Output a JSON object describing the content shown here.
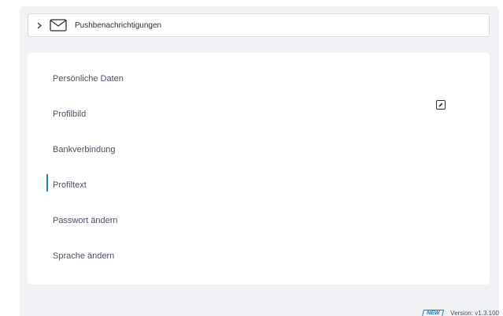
{
  "push_notifications": {
    "label": "Pushbenachrichtigungen",
    "chevron_icon": "chevron-right-icon",
    "mail_icon": "envelope-icon"
  },
  "profile_menu": {
    "items": [
      {
        "label": "Persönliche Daten"
      },
      {
        "label": "Profilbild"
      },
      {
        "label": "Bankverbindung"
      },
      {
        "label": "Profiltext",
        "active": true
      },
      {
        "label": "Passwort ändern"
      },
      {
        "label": "Sprache ändern"
      }
    ],
    "edit_icon": "pencil-edit-icon"
  },
  "footer": {
    "badge": "NEW",
    "version": "Version: v1.3.100"
  },
  "colors": {
    "accent": "#1d7fb8",
    "panel_bg": "#f0f2f5",
    "card_bg": "#ffffff",
    "text": "#4a5260"
  }
}
